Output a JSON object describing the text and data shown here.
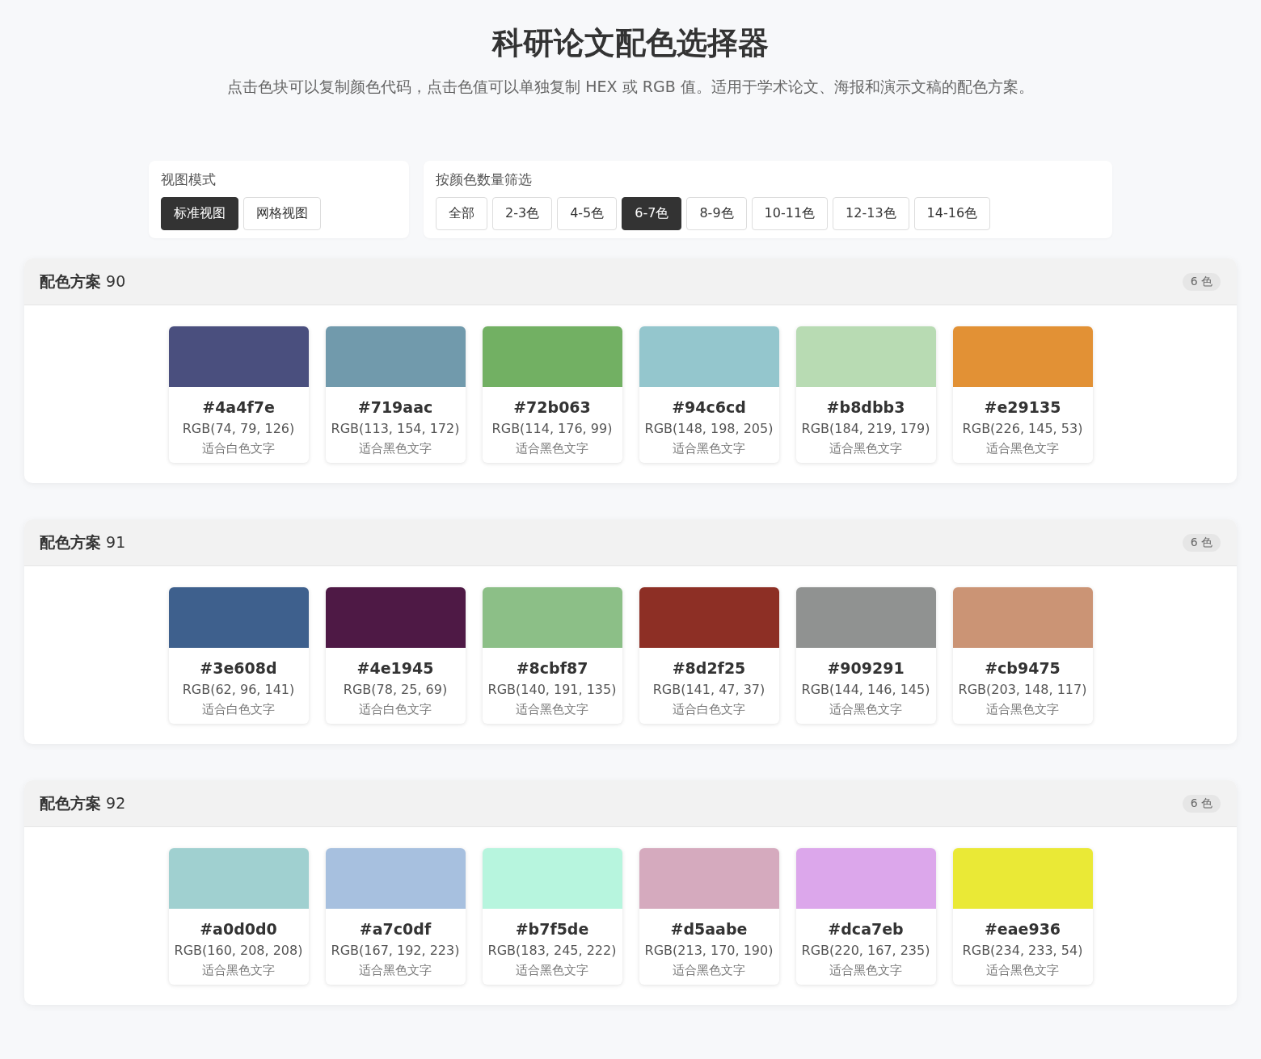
{
  "page": {
    "title": "科研论文配色选择器",
    "subtitle": "点击色块可以复制颜色代码，点击色值可以单独复制 HEX 或 RGB 值。适用于学术论文、海报和演示文稿的配色方案。"
  },
  "view_mode": {
    "label": "视图模式",
    "options": [
      {
        "label": "标准视图",
        "selected": true
      },
      {
        "label": "网格视图",
        "selected": false
      }
    ]
  },
  "filter": {
    "label": "按颜色数量筛选",
    "options": [
      {
        "label": "全部",
        "selected": false
      },
      {
        "label": "2-3色",
        "selected": false
      },
      {
        "label": "4-5色",
        "selected": false
      },
      {
        "label": "6-7色",
        "selected": true
      },
      {
        "label": "8-9色",
        "selected": false
      },
      {
        "label": "10-11色",
        "selected": false
      },
      {
        "label": "12-13色",
        "selected": false
      },
      {
        "label": "14-16色",
        "selected": false
      }
    ]
  },
  "palettes": [
    {
      "title": "**配色方案** 90",
      "count": "6 色",
      "swatches": [
        {
          "color": "#4a4f7e",
          "hex": "#4a4f7e",
          "rgb": "RGB(74, 79, 126)",
          "hint": "适合白色文字"
        },
        {
          "color": "#719aac",
          "hex": "#719aac",
          "rgb": "RGB(113, 154, 172)",
          "hint": "适合黑色文字"
        },
        {
          "color": "#72b063",
          "hex": "#72b063",
          "rgb": "RGB(114, 176, 99)",
          "hint": "适合黑色文字"
        },
        {
          "color": "#94c6cd",
          "hex": "#94c6cd",
          "rgb": "RGB(148, 198, 205)",
          "hint": "适合黑色文字"
        },
        {
          "color": "#b8dbb3",
          "hex": "#b8dbb3",
          "rgb": "RGB(184, 219, 179)",
          "hint": "适合黑色文字"
        },
        {
          "color": "#e29135",
          "hex": "#e29135",
          "rgb": "RGB(226, 145, 53)",
          "hint": "适合黑色文字"
        }
      ]
    },
    {
      "title": "**配色方案** 91",
      "count": "6 色",
      "swatches": [
        {
          "color": "#3e608d",
          "hex": "#3e608d",
          "rgb": "RGB(62, 96, 141)",
          "hint": "适合白色文字"
        },
        {
          "color": "#4e1945",
          "hex": "#4e1945",
          "rgb": "RGB(78, 25, 69)",
          "hint": "适合白色文字"
        },
        {
          "color": "#8cbf87",
          "hex": "#8cbf87",
          "rgb": "RGB(140, 191, 135)",
          "hint": "适合黑色文字"
        },
        {
          "color": "#8d2f25",
          "hex": "#8d2f25",
          "rgb": "RGB(141, 47, 37)",
          "hint": "适合白色文字"
        },
        {
          "color": "#909291",
          "hex": "#909291",
          "rgb": "RGB(144, 146, 145)",
          "hint": "适合黑色文字"
        },
        {
          "color": "#cb9475",
          "hex": "#cb9475",
          "rgb": "RGB(203, 148, 117)",
          "hint": "适合黑色文字"
        }
      ]
    },
    {
      "title": "**配色方案** 92",
      "count": "6 色",
      "swatches": [
        {
          "color": "#a0d0d0",
          "hex": "#a0d0d0",
          "rgb": "RGB(160, 208, 208)",
          "hint": "适合黑色文字"
        },
        {
          "color": "#a7c0df",
          "hex": "#a7c0df",
          "rgb": "RGB(167, 192, 223)",
          "hint": "适合黑色文字"
        },
        {
          "color": "#b7f5de",
          "hex": "#b7f5de",
          "rgb": "RGB(183, 245, 222)",
          "hint": "适合黑色文字"
        },
        {
          "color": "#d5aabe",
          "hex": "#d5aabe",
          "rgb": "RGB(213, 170, 190)",
          "hint": "适合黑色文字"
        },
        {
          "color": "#dca7eb",
          "hex": "#dca7eb",
          "rgb": "RGB(220, 167, 235)",
          "hint": "适合黑色文字"
        },
        {
          "color": "#eae936",
          "hex": "#eae936",
          "rgb": "RGB(234, 233, 54)",
          "hint": "适合黑色文字"
        }
      ]
    }
  ]
}
